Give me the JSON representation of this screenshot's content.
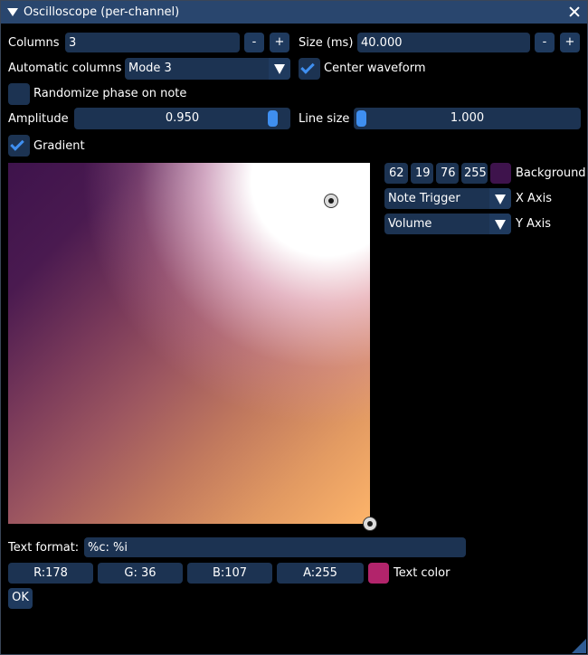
{
  "window": {
    "title": "Oscilloscope (per-channel)"
  },
  "columns": {
    "label": "Columns",
    "value": "3",
    "minus": "-",
    "plus": "+"
  },
  "size": {
    "label": "Size (ms)",
    "value": "40.000",
    "minus": "-",
    "plus": "+"
  },
  "automatic_columns": {
    "label": "Automatic columns",
    "value": "Mode 3"
  },
  "center_waveform": {
    "label": "Center waveform",
    "checked": true
  },
  "randomize_phase": {
    "label": "Randomize phase on note",
    "checked": false
  },
  "amplitude": {
    "label": "Amplitude",
    "value": "0.950",
    "fraction": 0.95
  },
  "line_size": {
    "label": "Line size",
    "value": "1.000",
    "fraction": 0.0
  },
  "gradient": {
    "label": "Gradient",
    "checked": true
  },
  "background": {
    "r": "62",
    "g": "19",
    "b": "76",
    "a": "255",
    "label": "Background",
    "color": "#3e134c"
  },
  "x_axis": {
    "value": "Note Trigger",
    "label": "X Axis"
  },
  "y_axis": {
    "value": "Volume",
    "label": "Y Axis"
  },
  "text_format": {
    "label": "Text format:",
    "value": "%c: %i"
  },
  "text_color": {
    "r": "R:178",
    "g": "G: 36",
    "b": "B:107",
    "a": "A:255",
    "label": "Text color",
    "color": "#b2246b"
  },
  "ok_button": "OK",
  "colors": {
    "title_bar": "#29466e",
    "frame_bg": "#1c3352",
    "button_bg": "#1f3a5e",
    "accent": "#3f8ff0"
  }
}
